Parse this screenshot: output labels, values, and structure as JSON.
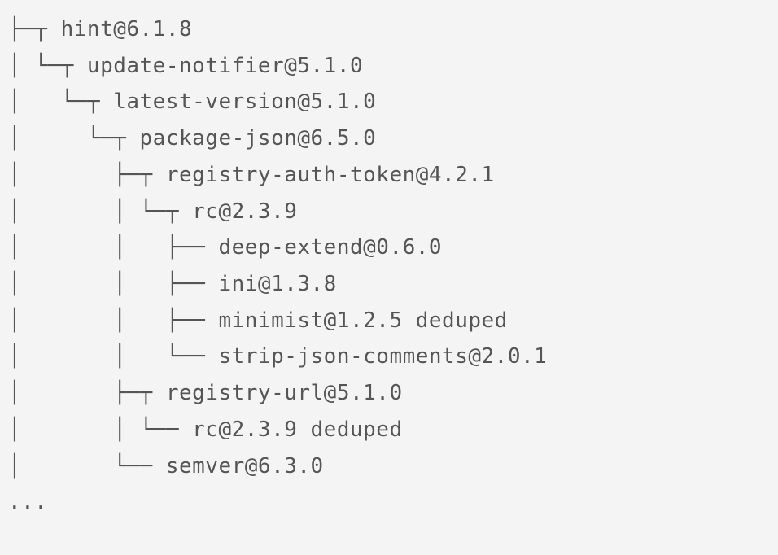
{
  "tree": {
    "root": {
      "label": "hint@6.1.8",
      "children": [
        {
          "label": "update-notifier@5.1.0",
          "last": true,
          "children": [
            {
              "label": "latest-version@5.1.0",
              "children": [
                {
                  "label": "package-json@6.5.0",
                  "last": true,
                  "children": [
                    {
                      "label": "registry-auth-token@4.2.1",
                      "children": [
                        {
                          "label": "rc@2.3.9",
                          "last": true,
                          "children": [
                            {
                              "label": "deep-extend@0.6.0"
                            },
                            {
                              "label": "ini@1.3.8"
                            },
                            {
                              "label": "minimist@1.2.5 deduped"
                            },
                            {
                              "label": "strip-json-comments@2.0.1",
                              "last": true
                            }
                          ]
                        }
                      ]
                    },
                    {
                      "label": "registry-url@5.1.0",
                      "children": [
                        {
                          "label": "rc@2.3.9 deduped",
                          "last": true
                        }
                      ]
                    },
                    {
                      "label": "semver@6.3.0",
                      "last": true
                    }
                  ]
                }
              ]
            }
          ]
        }
      ]
    },
    "ellipsis": "..."
  },
  "glyphs": {
    "tee": "├─┬ ",
    "teeL": "├── ",
    "elbow": "└─┬ ",
    "elbowL": "└── ",
    "pipe": "│ ",
    "space": "  "
  }
}
